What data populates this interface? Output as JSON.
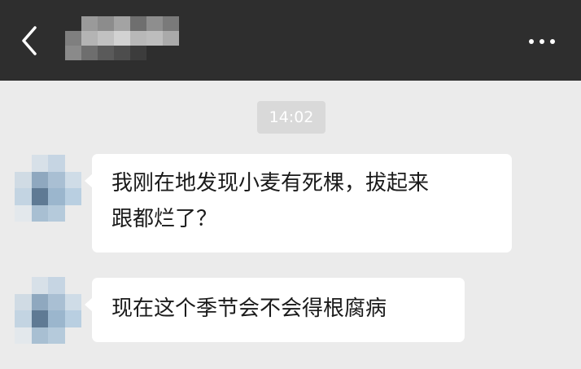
{
  "header": {
    "back_icon": "chevron-left-icon",
    "more_icon": "more-dots-icon",
    "colors": {
      "bar": "#2e2e2e",
      "icon": "#ffffff"
    }
  },
  "chat": {
    "timestamp": "14:02",
    "messages": [
      {
        "sender": "other",
        "lines": [
          "我刚在地发现小麦有死棵，拔起来",
          "跟都烂了？"
        ]
      },
      {
        "sender": "other",
        "lines": [
          "现在这个季节会不会得根腐病"
        ]
      }
    ]
  },
  "colors": {
    "background": "#ebebeb",
    "bubble": "#ffffff",
    "timestamp_bg": "#d9d9d9"
  }
}
